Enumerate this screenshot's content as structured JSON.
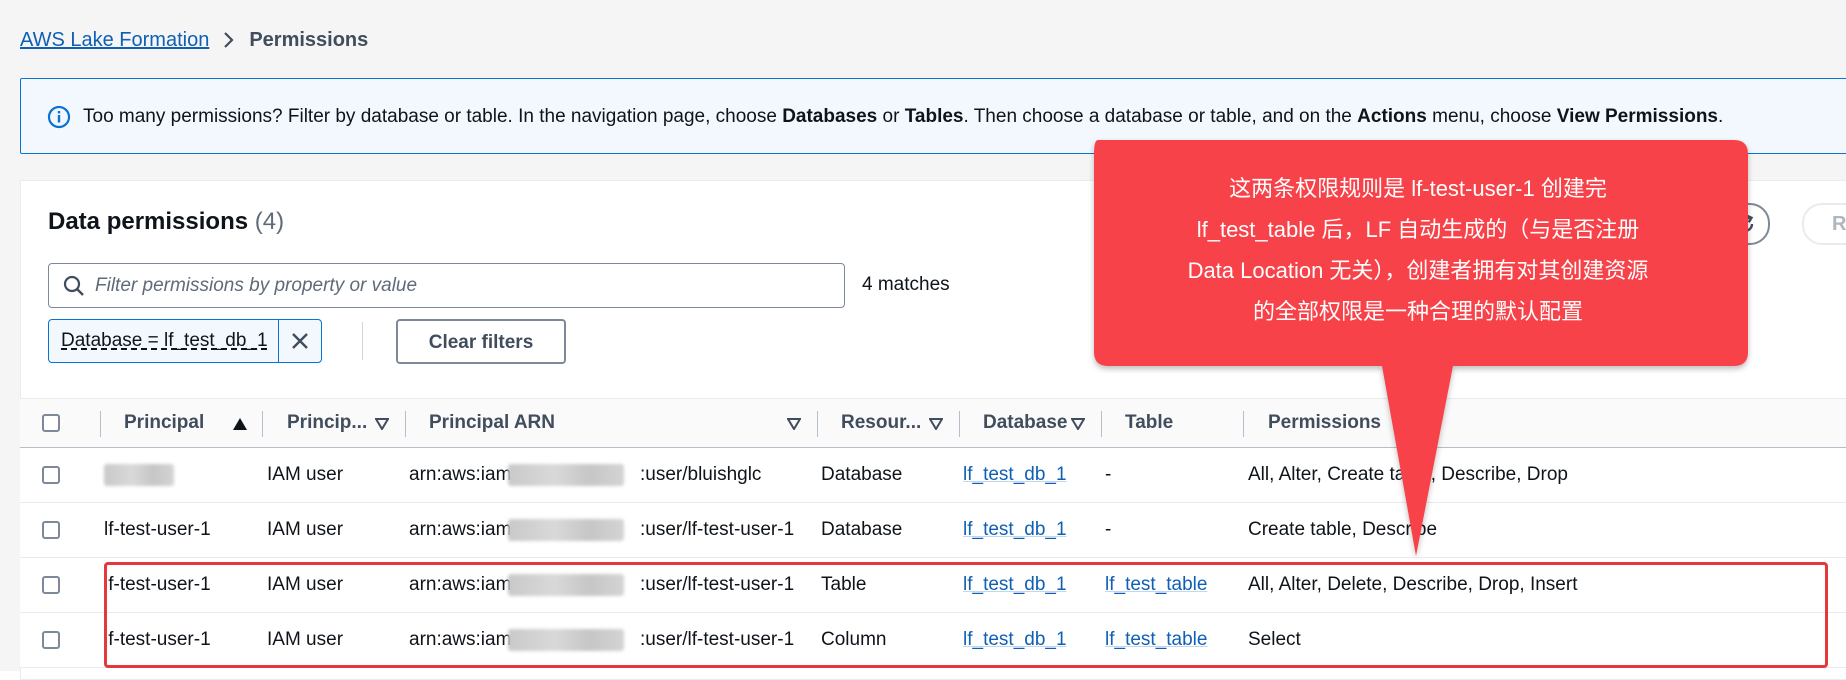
{
  "breadcrumb": {
    "root": "AWS Lake Formation",
    "current": "Permissions"
  },
  "alert": {
    "icon": "info-icon",
    "t1": "Too many permissions? Filter by database or table. In the navigation page, choose ",
    "b1": "Databases",
    "t2": " or ",
    "b2": "Tables",
    "t3": ". Then choose a database or table, and on the ",
    "b3": "Actions",
    "t4": " menu, choose ",
    "b4": "View Permissions",
    "t5": "."
  },
  "panel": {
    "title": "Data permissions",
    "count": "(4)",
    "right_button_label": "Re"
  },
  "search": {
    "placeholder": "Filter permissions by property or value",
    "value": "",
    "matches": "4 matches"
  },
  "filter_token": {
    "label": "Database = lf_test_db_1"
  },
  "clear_filters_label": "Clear filters",
  "table": {
    "headers": {
      "principal": "Principal",
      "principal_type": "Princip...",
      "principal_arn": "Principal ARN",
      "resource_type": "Resour...",
      "database": "Database",
      "table": "Table",
      "permissions": "Permissions"
    },
    "rows": [
      {
        "principal": "",
        "principal_type": "IAM user",
        "arn_prefix": "arn:aws:iam::",
        "arn_suffix": ":user/bluishglc",
        "resource_type": "Database",
        "database": "lf_test_db_1",
        "table": "-",
        "permissions": "All, Alter, Create table, Describe, Drop"
      },
      {
        "principal": "lf-test-user-1",
        "principal_type": "IAM user",
        "arn_prefix": "arn:aws:iam::",
        "arn_suffix": ":user/lf-test-user-1",
        "resource_type": "Database",
        "database": "lf_test_db_1",
        "table": "-",
        "permissions": "Create table, Describe"
      },
      {
        "principal": "lf-test-user-1",
        "principal_type": "IAM user",
        "arn_prefix": "arn:aws:iam::",
        "arn_suffix": ":user/lf-test-user-1",
        "resource_type": "Table",
        "database": "lf_test_db_1",
        "table": "lf_test_table",
        "permissions": "All, Alter, Delete, Describe, Drop, Insert"
      },
      {
        "principal": "lf-test-user-1",
        "principal_type": "IAM user",
        "arn_prefix": "arn:aws:iam::",
        "arn_suffix": ":user/lf-test-user-1",
        "resource_type": "Column",
        "database": "lf_test_db_1",
        "table": "lf_test_table",
        "permissions": "Select"
      }
    ]
  },
  "annotation": {
    "lines": [
      "这两条权限规则是 lf-test-user-1 创建完",
      "lf_test_table 后，LF 自动生成的（与是否注册",
      "Data Location 无关），创建者拥有对其创建资源",
      "的全部权限是一种合理的默认配置"
    ],
    "color": "#f8424a"
  },
  "colors": {
    "link": "#0f5fb5",
    "alert_border": "#0972d3",
    "highlight_border": "#e5383b"
  }
}
